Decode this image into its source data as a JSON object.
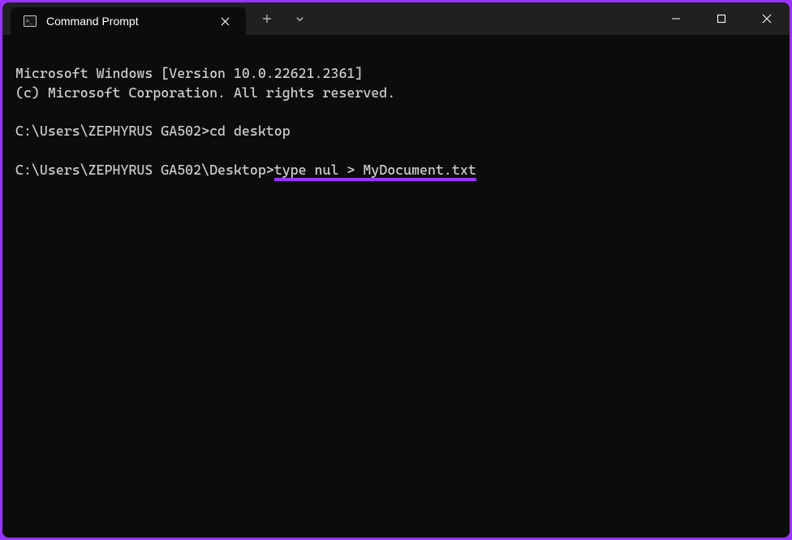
{
  "tab": {
    "title": "Command Prompt"
  },
  "terminal": {
    "line1": "Microsoft Windows [Version 10.0.22621.2361]",
    "line2": "(c) Microsoft Corporation. All rights reserved.",
    "blank1": "",
    "prompt1_path": "C:\\Users\\ZEPHYRUS GA502>",
    "prompt1_cmd": "cd desktop",
    "blank2": "",
    "prompt2_path": "C:\\Users\\ZEPHYRUS GA502\\Desktop>",
    "prompt2_cmd": "type nul > MyDocument.txt"
  }
}
